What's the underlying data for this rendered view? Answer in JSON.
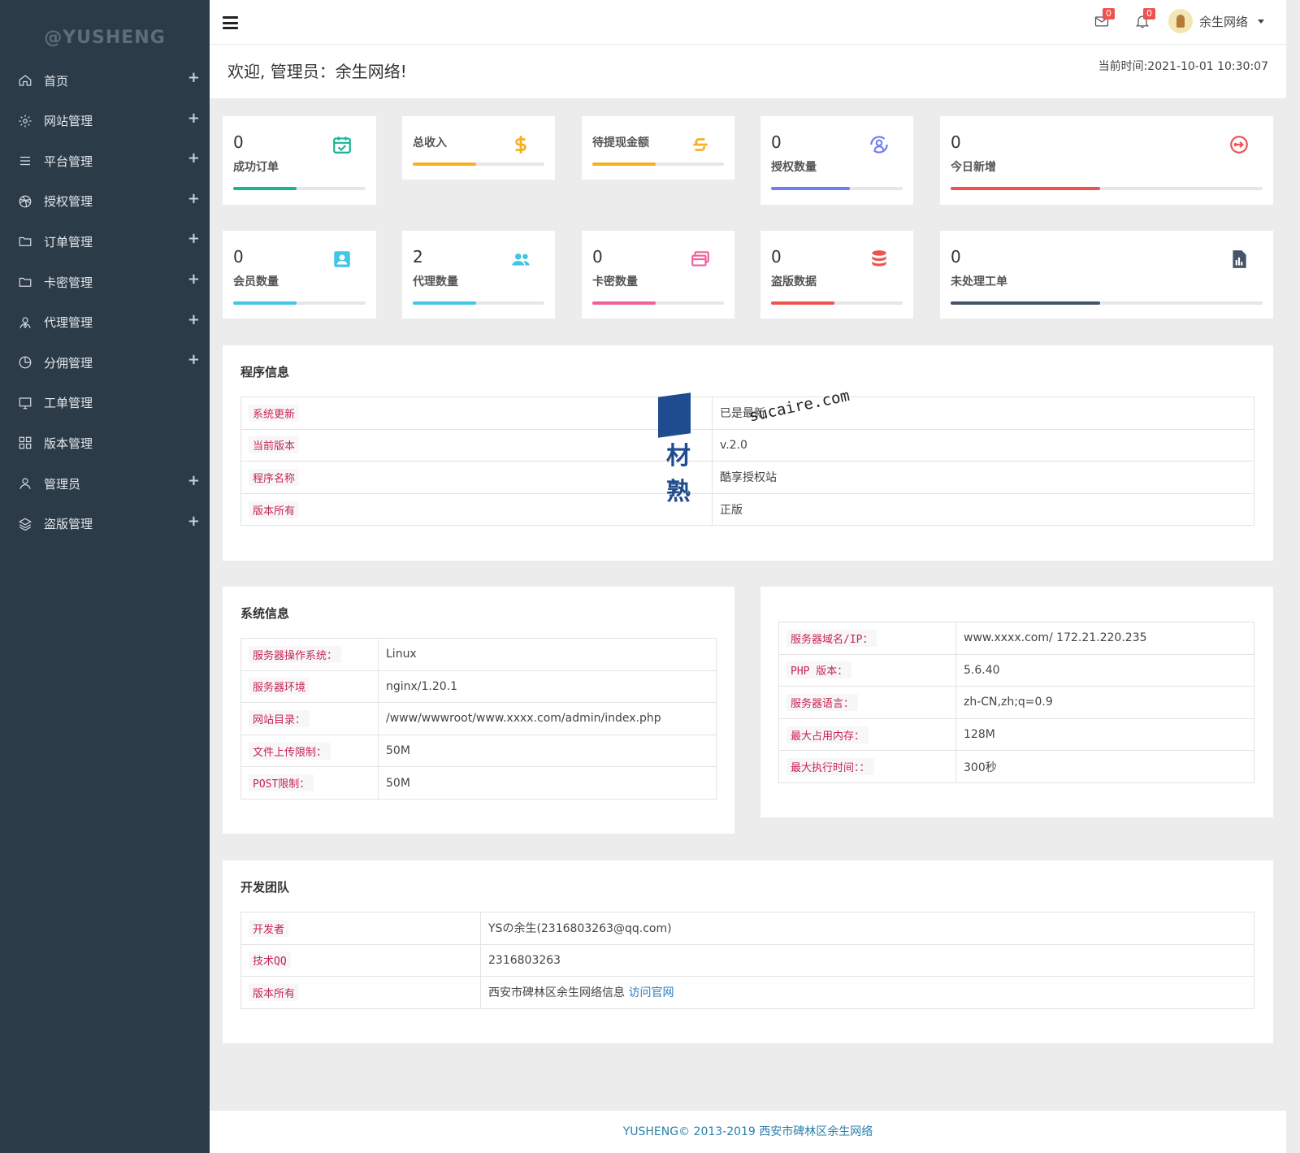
{
  "sidebar": {
    "logo": "@YUSHENG",
    "items": [
      {
        "label": "首页",
        "icon": "home-icon",
        "has_plus": true
      },
      {
        "label": "网站管理",
        "icon": "gear-icon",
        "has_plus": true
      },
      {
        "label": "平台管理",
        "icon": "list-icon",
        "has_plus": true
      },
      {
        "label": "授权管理",
        "icon": "dribbble-icon",
        "has_plus": true
      },
      {
        "label": "订单管理",
        "icon": "folder-icon",
        "has_plus": true
      },
      {
        "label": "卡密管理",
        "icon": "folder-icon",
        "has_plus": true
      },
      {
        "label": "代理管理",
        "icon": "agent-icon",
        "has_plus": true
      },
      {
        "label": "分佣管理",
        "icon": "pie-icon",
        "has_plus": true
      },
      {
        "label": "工单管理",
        "icon": "monitor-icon",
        "has_plus": false
      },
      {
        "label": "版本管理",
        "icon": "grid-icon",
        "has_plus": false
      },
      {
        "label": "管理员",
        "icon": "user-icon",
        "has_plus": true
      },
      {
        "label": "盗版管理",
        "icon": "layers-icon",
        "has_plus": true
      }
    ],
    "plus_symbol": "+"
  },
  "topbar": {
    "mail_count": "0",
    "bell_count": "0",
    "username": "余生网络"
  },
  "welcome": {
    "title": "欢迎, 管理员：余生网络!",
    "current_time": "当前时间:2021-10-01 10:30:07"
  },
  "stats": [
    {
      "value": "0",
      "label": "成功订单",
      "icon": "calendar-check-icon",
      "color": "#1ab394",
      "progress": 0.48
    },
    {
      "value": "",
      "label": "总收入",
      "icon": "dollar-icon",
      "color": "#f4b125",
      "progress": 0.48
    },
    {
      "value": "",
      "label": "待提现金额",
      "icon": "strikethrough-dollar-icon",
      "color": "#f4b125",
      "progress": 0.48
    },
    {
      "value": "0",
      "label": "授权数量",
      "icon": "user-sync-icon",
      "color": "#6f7ef5",
      "progress": 0.6
    },
    {
      "value": "0",
      "label": "今日新增",
      "icon": "login-circle-icon",
      "color": "#ef5350",
      "progress": 0.48
    },
    {
      "value": "0",
      "label": "会员数量",
      "icon": "user-card-icon",
      "color": "#42c6e5",
      "progress": 0.48
    },
    {
      "value": "2",
      "label": "代理数量",
      "icon": "users-icon",
      "color": "#42c6e5",
      "progress": 0.48
    },
    {
      "value": "0",
      "label": "卡密数量",
      "icon": "cards-icon",
      "color": "#f0609c",
      "progress": 0.48
    },
    {
      "value": "0",
      "label": "盗版数据",
      "icon": "database-icon",
      "color": "#ef5350",
      "progress": 0.48
    },
    {
      "value": "0",
      "label": "未处理工单",
      "icon": "report-icon",
      "color": "#455468",
      "progress": 0.48
    }
  ],
  "program_info": {
    "title": "程序信息",
    "rows": [
      {
        "key": "系统更新",
        "value": "已是最新"
      },
      {
        "key": "当前版本",
        "value": "v.2.0"
      },
      {
        "key": "程序名称",
        "value": "酷享授权站"
      },
      {
        "key": "版本所有",
        "value": "正版"
      }
    ]
  },
  "system_info": {
    "title": "系统信息",
    "rows": [
      {
        "key": "服务器操作系统：",
        "value": "Linux"
      },
      {
        "key": "服务器环境",
        "value": "nginx/1.20.1"
      },
      {
        "key": "网站目录：",
        "value": "/www/wwwroot/www.xxxx.com/admin/index.php"
      },
      {
        "key": "文件上传限制：",
        "value": "50M"
      },
      {
        "key": "POST限制：",
        "value": "50M"
      }
    ]
  },
  "server_info": {
    "rows": [
      {
        "key": "服务器域名/IP：",
        "value": "www.xxxx.com/ 172.21.220.235"
      },
      {
        "key": "PHP 版本：",
        "value": "5.6.40"
      },
      {
        "key": "服务器语言：",
        "value": "zh-CN,zh;q=0.9"
      },
      {
        "key": "最大占用内存：",
        "value": "128M"
      },
      {
        "key": "最大执行时间：：",
        "value": "300秒"
      }
    ]
  },
  "dev_team": {
    "title": "开发团队",
    "rows": [
      {
        "key": "开发者",
        "value": "YSの余生(2316803263@qq.com)"
      },
      {
        "key": "技术QQ",
        "value": "2316803263"
      },
      {
        "key": "版本所有",
        "value": "西安市碑林区余生网络信息",
        "link": "访问官网"
      }
    ]
  },
  "footer": {
    "text": "YUSHENG© 2013-2019 西安市碑林区余生网络"
  },
  "watermark": {
    "cn_text": "素材熟",
    "en_text": "sucaire.com"
  }
}
